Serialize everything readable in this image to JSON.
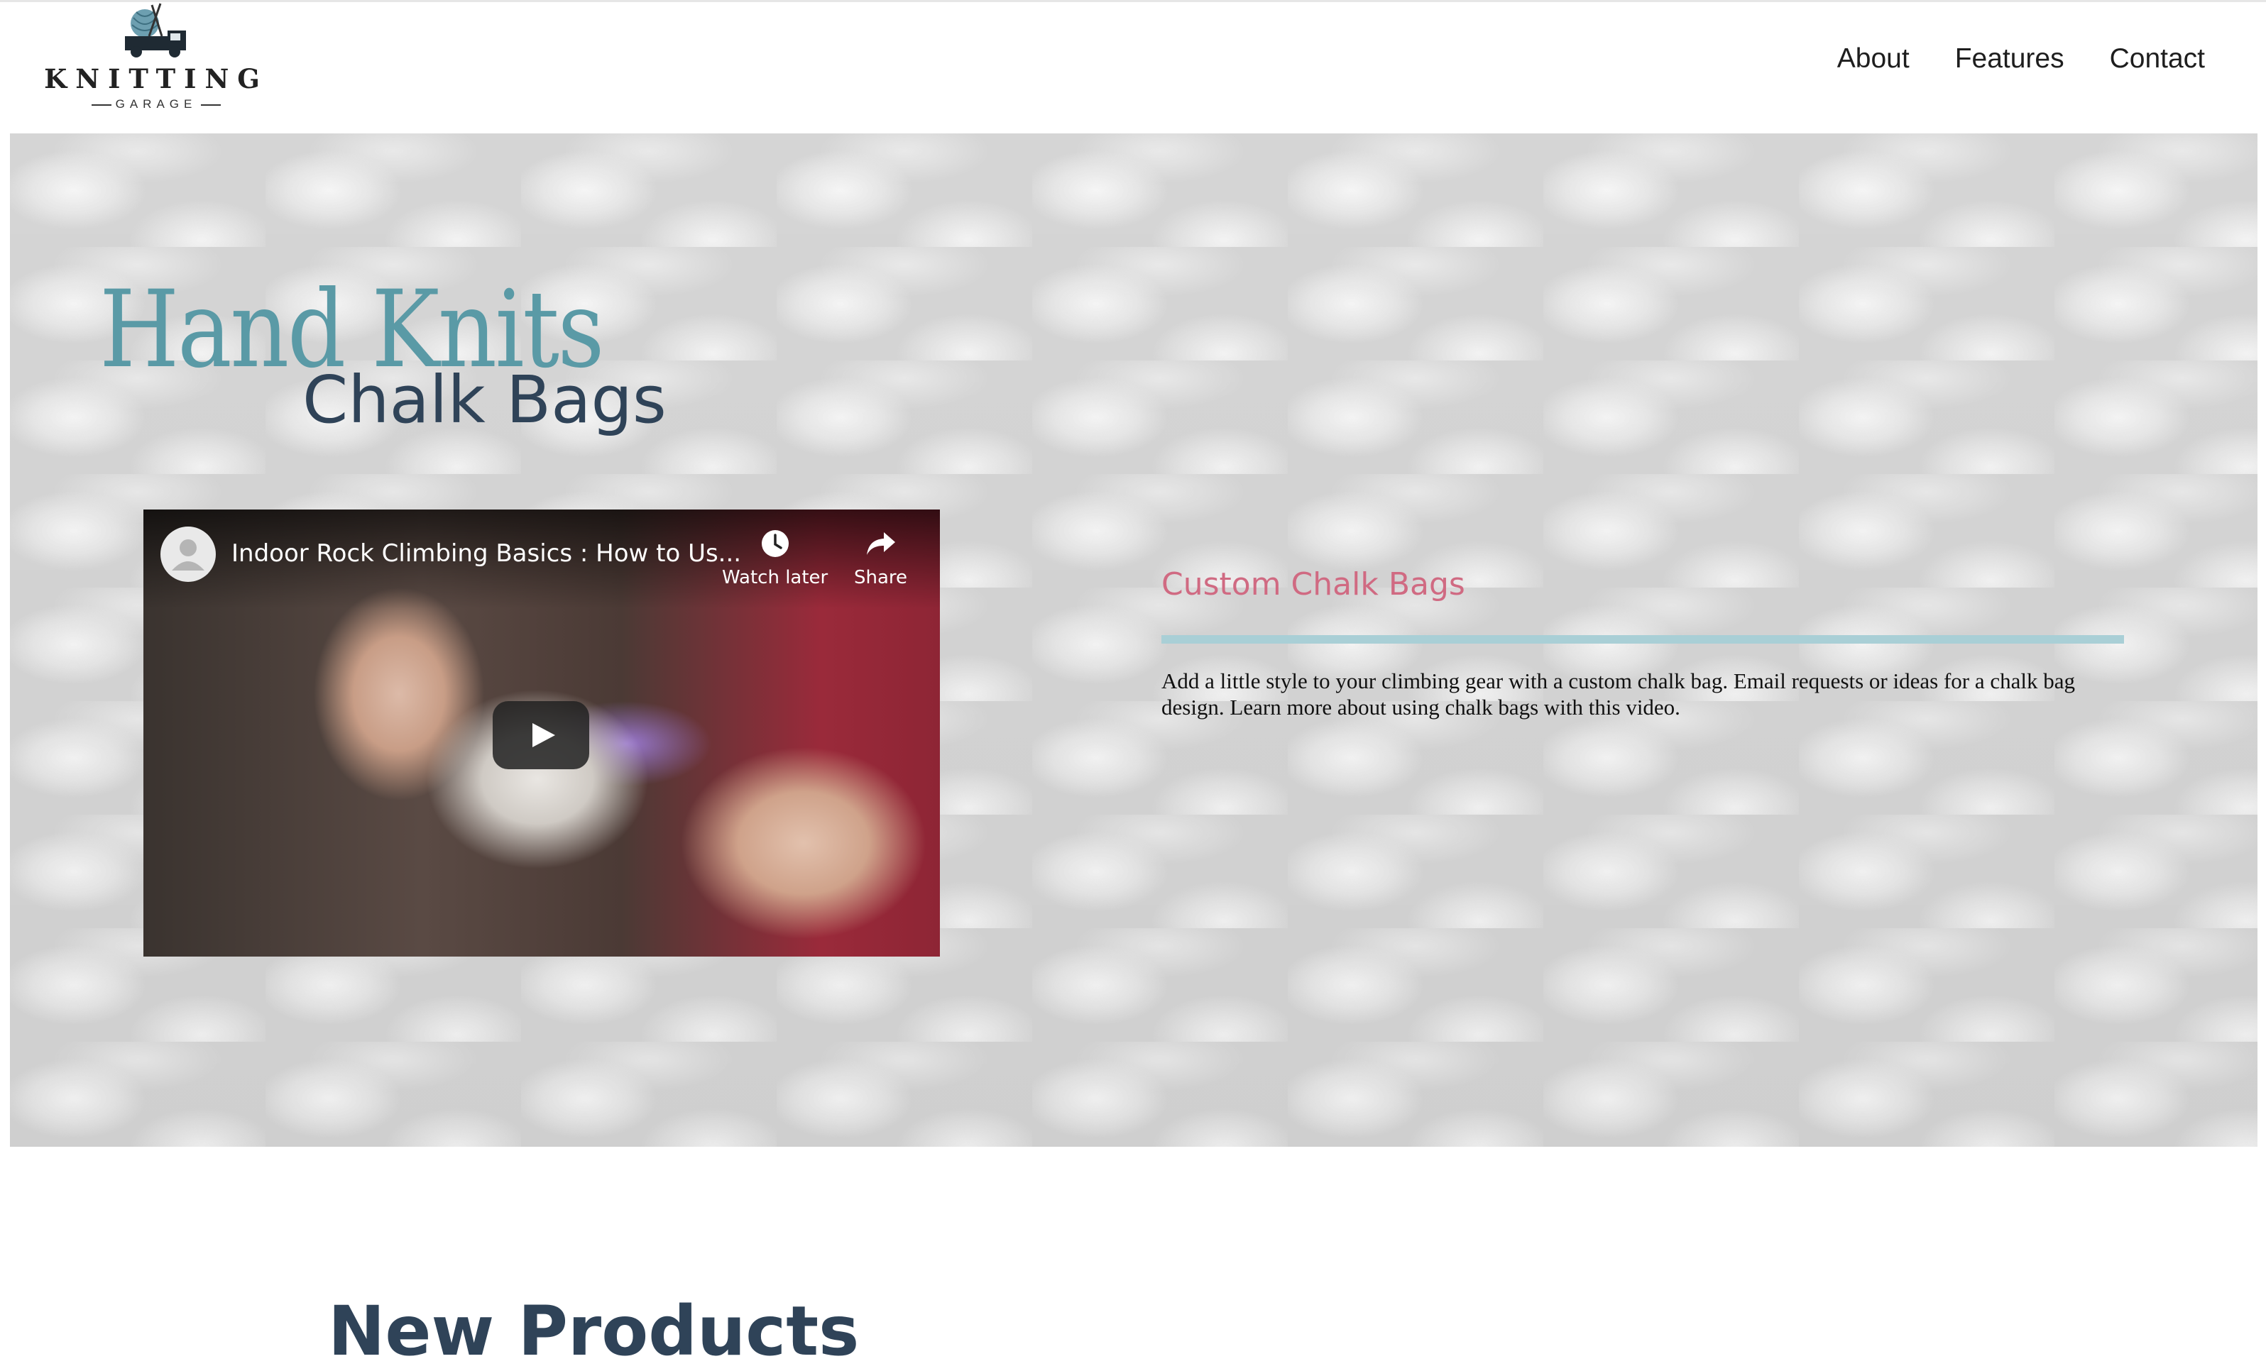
{
  "brand": {
    "name": "KNITTING",
    "sub": "GARAGE"
  },
  "nav": {
    "items": [
      "About",
      "Features",
      "Contact"
    ]
  },
  "hero": {
    "title": "Hand Knits",
    "subtitle": "Chalk Bags",
    "video": {
      "title": "Indoor Rock Climbing Basics : How to Us...",
      "watch_later": "Watch later",
      "share": "Share"
    },
    "card": {
      "heading": "Custom Chalk Bags",
      "text": "Add a little style to your climbing gear with a custom chalk bag. Email requests or ideas for a chalk bag design. Learn more about using chalk bags with this video."
    }
  },
  "products": {
    "heading": "New Products"
  },
  "colors": {
    "title": "#5a9aa6",
    "subtitle": "#2f4358",
    "accent": "#d06a82",
    "rule": "#a9cfd6"
  }
}
